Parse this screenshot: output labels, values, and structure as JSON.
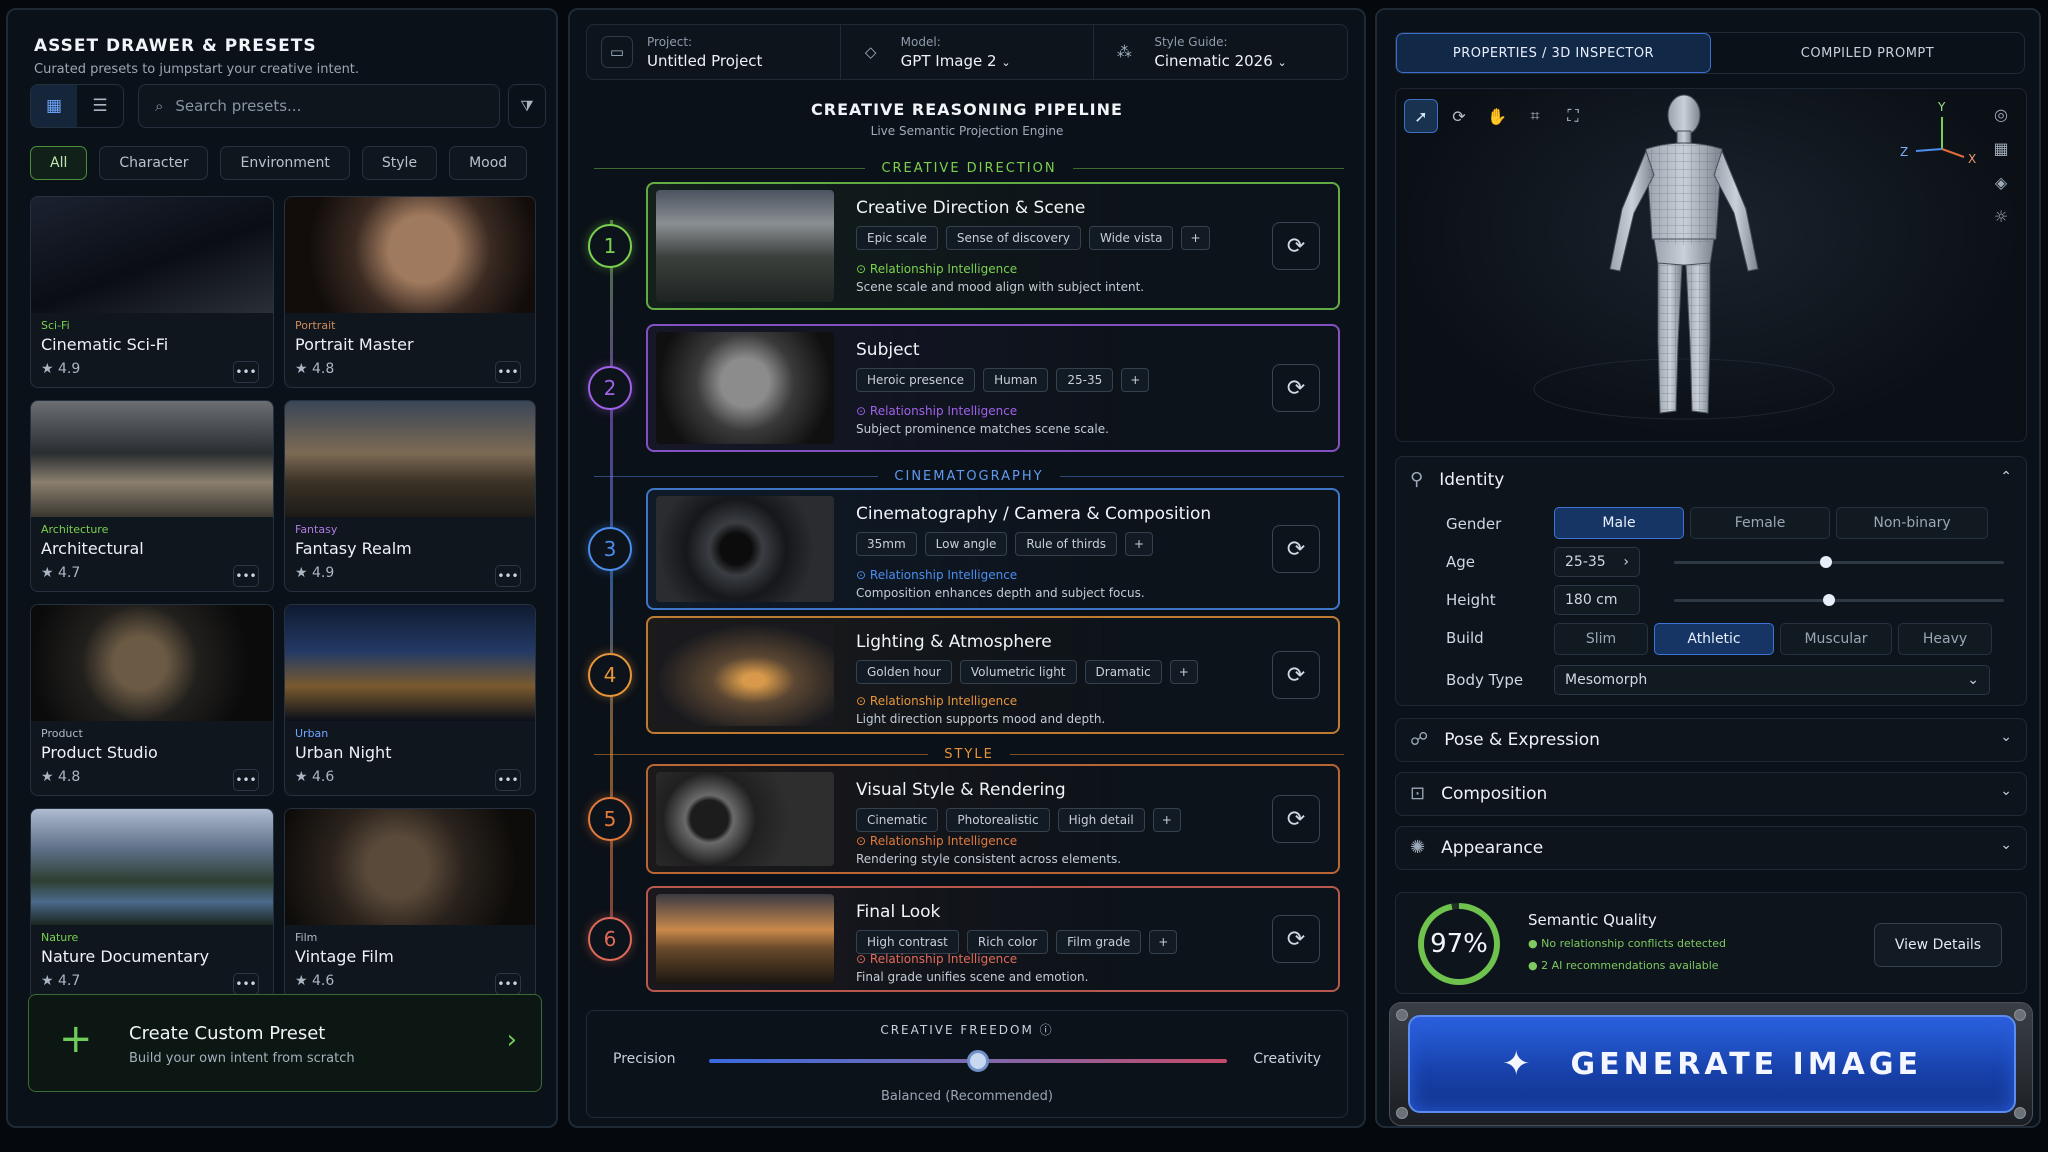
{
  "left": {
    "title": "ASSET DRAWER & PRESETS",
    "subtitle": "Curated presets to jumpstart your creative intent.",
    "search_placeholder": "Search presets...",
    "filters": [
      "All",
      "Character",
      "Environment",
      "Style",
      "Mood"
    ],
    "presets": [
      {
        "category": "Sci-Fi",
        "name": "Cinematic Sci-Fi",
        "rating": "4.9",
        "color": "#7bd14f"
      },
      {
        "category": "Portrait",
        "name": "Portrait Master",
        "rating": "4.8",
        "color": "#d08a5a"
      },
      {
        "category": "Architecture",
        "name": "Architectural",
        "rating": "4.7",
        "color": "#7bd14f"
      },
      {
        "category": "Fantasy",
        "name": "Fantasy Realm",
        "rating": "4.9",
        "color": "#b07be0"
      },
      {
        "category": "Product",
        "name": "Product Studio",
        "rating": "4.8",
        "color": "#b0b8c4"
      },
      {
        "category": "Urban",
        "name": "Urban Night",
        "rating": "4.6",
        "color": "#6ea6ff"
      },
      {
        "category": "Nature",
        "name": "Nature Documentary",
        "rating": "4.7",
        "color": "#7bd14f"
      },
      {
        "category": "Film",
        "name": "Vintage Film",
        "rating": "4.6",
        "color": "#b0b8c4"
      }
    ],
    "create": {
      "title": "Create Custom Preset",
      "subtitle": "Build your own intent from scratch"
    }
  },
  "center": {
    "project_label": "Project:",
    "project_value": "Untitled Project",
    "model_label": "Model:",
    "model_value": "GPT Image 2",
    "style_label": "Style Guide:",
    "style_value": "Cinematic 2026",
    "title": "CREATIVE REASONING PIPELINE",
    "subtitle": "Live Semantic Projection Engine",
    "sections": {
      "creative": "CREATIVE DIRECTION",
      "cinema": "CINEMATOGRAPHY",
      "style": "STYLE"
    },
    "stages": [
      {
        "num": "1",
        "title": "Creative Direction & Scene",
        "tags": [
          "Epic scale",
          "Sense of discovery",
          "Wide vista"
        ],
        "ri": "Relationship Intelligence",
        "desc": "Scene scale and mood align with subject intent.",
        "color": "#7bd14f"
      },
      {
        "num": "2",
        "title": "Subject",
        "tags": [
          "Heroic presence",
          "Human",
          "25-35"
        ],
        "ri": "Relationship Intelligence",
        "desc": "Subject prominence matches scene scale.",
        "color": "#a062e8"
      },
      {
        "num": "3",
        "title": "Cinematography / Camera & Composition",
        "tags": [
          "35mm",
          "Low angle",
          "Rule of thirds"
        ],
        "ri": "Relationship Intelligence",
        "desc": "Composition enhances depth and subject focus.",
        "color": "#4b8ef0"
      },
      {
        "num": "4",
        "title": "Lighting & Atmosphere",
        "tags": [
          "Golden hour",
          "Volumetric light",
          "Dramatic"
        ],
        "ri": "Relationship Intelligence",
        "desc": "Light direction supports mood and depth.",
        "color": "#e8953a"
      },
      {
        "num": "5",
        "title": "Visual Style & Rendering",
        "tags": [
          "Cinematic",
          "Photorealistic",
          "High detail"
        ],
        "ri": "Relationship Intelligence",
        "desc": "Rendering style consistent across elements.",
        "color": "#e27a3c"
      },
      {
        "num": "6",
        "title": "Final Look",
        "tags": [
          "High contrast",
          "Rich color",
          "Film grade"
        ],
        "ri": "Relationship Intelligence",
        "desc": "Final grade unifies scene and emotion.",
        "color": "#e06a5a"
      }
    ],
    "freedom": {
      "title": "CREATIVE FREEDOM",
      "left": "Precision",
      "right": "Creativity",
      "value_label": "Balanced (Recommended)",
      "value": 0.52
    }
  },
  "right": {
    "tabs": [
      "PROPERTIES / 3D INSPECTOR",
      "COMPILED PROMPT"
    ],
    "axes": {
      "y": "Y",
      "z": "Z",
      "x": "X"
    },
    "identity": {
      "title": "Identity",
      "gender_label": "Gender",
      "gender_options": [
        "Male",
        "Female",
        "Non-binary"
      ],
      "age_label": "Age",
      "age_value": "25-35",
      "age_slider": 0.46,
      "height_label": "Height",
      "height_value": "180 cm",
      "height_slider": 0.47,
      "build_label": "Build",
      "build_options": [
        "Slim",
        "Athletic",
        "Muscular",
        "Heavy"
      ],
      "body_label": "Body Type",
      "body_value": "Mesomorph"
    },
    "sections": [
      "Pose & Expression",
      "Composition",
      "Appearance"
    ],
    "quality": {
      "value": "97%",
      "title": "Semantic Quality",
      "line1": "No relationship conflicts detected",
      "line2": "2 AI recommendations available",
      "button": "View Details"
    },
    "generate": "GENERATE IMAGE"
  }
}
